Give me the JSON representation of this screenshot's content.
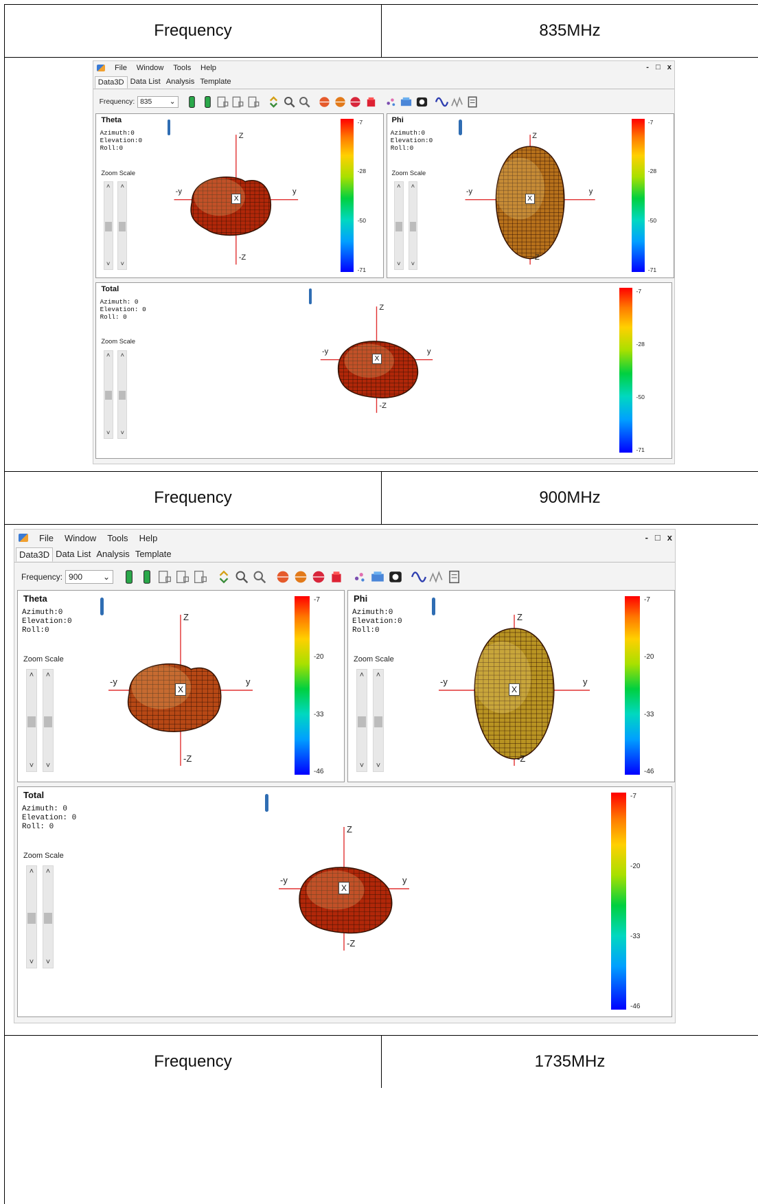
{
  "rows": [
    {
      "label": "Frequency",
      "value": "835MHz"
    },
    {
      "label": "Frequency",
      "value": "900MHz"
    },
    {
      "label": "Frequency",
      "value": "1735MHz"
    }
  ],
  "app": {
    "menu": [
      "File",
      "Window",
      "Tools",
      "Help"
    ],
    "window_controls": [
      "-",
      "□",
      "x"
    ],
    "tabs": [
      "Data3D",
      "Data List",
      "Analysis",
      "Template"
    ],
    "frequency_label": "Frequency:",
    "toolbar_icons": [
      "phone-green-icon",
      "phone-battery-icon",
      "device-outline-icon",
      "device-outline-2-icon",
      "device-outline-3-icon",
      "refresh-arrows-icon",
      "zoom-in-icon",
      "zoom-out-icon",
      "sphere-color-icon",
      "split-sphere-icon",
      "red-ball-icon",
      "grid-icon",
      "scatter-icon",
      "chart-icon",
      "camera-icon",
      "wave-icon",
      "signal-icon",
      "notes-icon"
    ],
    "zoom_label": "Zoom Scale",
    "axes": {
      "z": "Z",
      "neg_z": "-Z",
      "y": "y",
      "neg_y": "-y",
      "x": "X"
    }
  },
  "shots": [
    {
      "frequency": "835",
      "panels": {
        "theta": {
          "title": "Theta",
          "azimuth": "Azimuth:0",
          "elevation": "Elevation:0",
          "roll": "Roll:0",
          "ticks": [
            "-7",
            "-28",
            "-50",
            "-71"
          ]
        },
        "phi": {
          "title": "Phi",
          "azimuth": "Azimuth:0",
          "elevation": "Elevation:0",
          "roll": "Roll:0",
          "ticks": [
            "-7",
            "-28",
            "-50",
            "-71"
          ]
        },
        "total": {
          "title": "Total",
          "azimuth": "Azimuth: 0",
          "elevation": "Elevation: 0",
          "roll": "Roll: 0",
          "ticks": [
            "-7",
            "-28",
            "-50",
            "-71"
          ]
        }
      }
    },
    {
      "frequency": "900",
      "panels": {
        "theta": {
          "title": "Theta",
          "azimuth": "Azimuth:0",
          "elevation": "Elevation:0",
          "roll": "Roll:0",
          "ticks": [
            "-7",
            "-20",
            "-33",
            "-46"
          ]
        },
        "phi": {
          "title": "Phi",
          "azimuth": "Azimuth:0",
          "elevation": "Elevation:0",
          "roll": "Roll:0",
          "ticks": [
            "-7",
            "-20",
            "-33",
            "-46"
          ]
        },
        "total": {
          "title": "Total",
          "azimuth": "Azimuth: 0",
          "elevation": "Elevation: 0",
          "roll": "Roll: 0",
          "ticks": [
            "-7",
            "-20",
            "-33",
            "-46"
          ]
        }
      }
    }
  ],
  "colors": {
    "pattern_red": "#d8300c",
    "pattern_orange": "#e08a22",
    "pattern_yellow": "#e2b52a",
    "axis_red": "#e03030",
    "marker_blue": "#2f6db3"
  }
}
